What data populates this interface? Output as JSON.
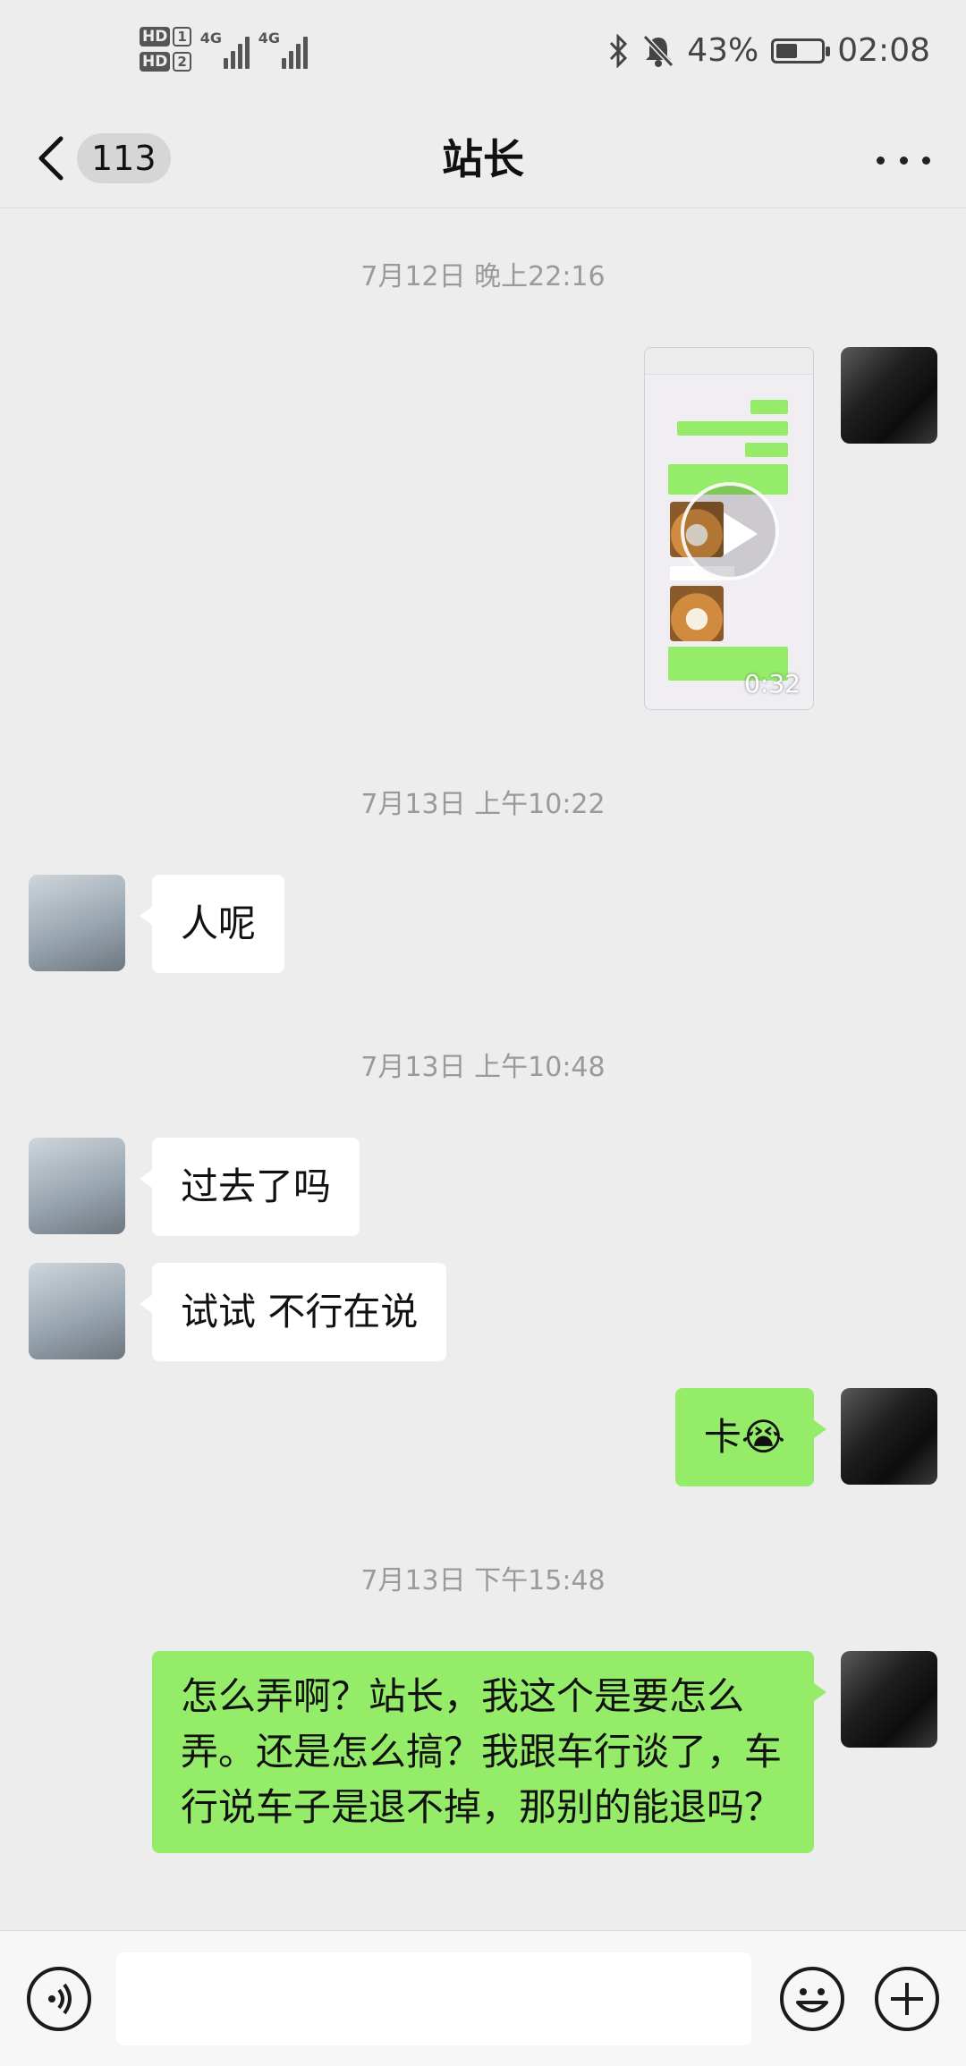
{
  "status_bar": {
    "sim1": "HD",
    "sim1_slot": "1",
    "sim2": "HD",
    "sim2_slot": "2",
    "network1": "4G",
    "network2": "4G",
    "battery": "43%",
    "time": "02:08"
  },
  "header": {
    "unread_count": "113",
    "title": "站长"
  },
  "messages": {
    "ts1": "7月12日 晚上22:16",
    "video_duration": "0:32",
    "ts2": "7月13日 上午10:22",
    "m1": "人呢",
    "ts3": "7月13日 上午10:48",
    "m2": "过去了吗",
    "m3": "试试 不行在说",
    "m4": "卡😭",
    "ts4": "7月13日 下午15:48",
    "m5": "怎么弄啊？站长，我这个是要怎么弄。还是怎么搞？我跟车行谈了，车行说车子是退不掉，那别的能退吗？"
  },
  "colors": {
    "background": "#ededed",
    "outgoing_bubble": "#95ec69",
    "incoming_bubble": "#ffffff"
  }
}
